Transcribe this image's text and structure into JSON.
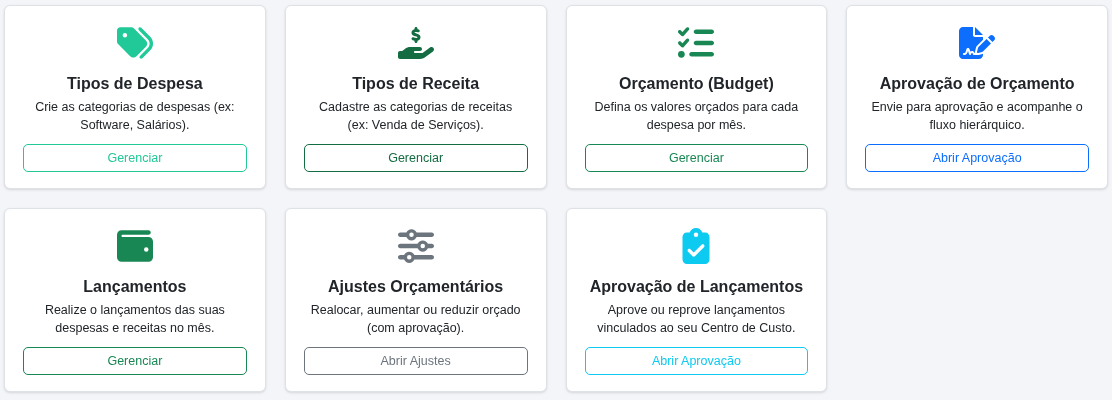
{
  "cards": [
    {
      "color": "#20c997",
      "title": "Tipos de Despesa",
      "description": "Crie as categorias de despesas (ex: Software, Salários).",
      "button": "Gerenciar"
    },
    {
      "color": "#146c43",
      "title": "Tipos de Receita",
      "description": "Cadastre as categorias de receitas (ex: Venda de Serviços).",
      "button": "Gerenciar"
    },
    {
      "color": "#198754",
      "title": "Orçamento (Budget)",
      "description": "Defina os valores orçados para cada despesa por mês.",
      "button": "Gerenciar"
    },
    {
      "color": "#0d6efd",
      "title": "Aprovação de Orçamento",
      "description": "Envie para aprovação e acompanhe o fluxo hierárquico.",
      "button": "Abrir Aprovação"
    },
    {
      "color": "#198754",
      "title": "Lançamentos",
      "description": "Realize o lançamentos das suas despesas e receitas no mês.",
      "button": "Gerenciar"
    },
    {
      "color": "#6c757d",
      "title": "Ajustes Orçamentários",
      "description": "Realocar, aumentar ou reduzir orçado (com aprovação).",
      "button": "Abrir Ajustes"
    },
    {
      "color": "#0dcaf0",
      "title": "Aprovação de Lançamentos",
      "description": "Aprove ou reprove lançamentos vinculados ao seu Centro de Custo.",
      "button": "Abrir Aprovação"
    }
  ]
}
